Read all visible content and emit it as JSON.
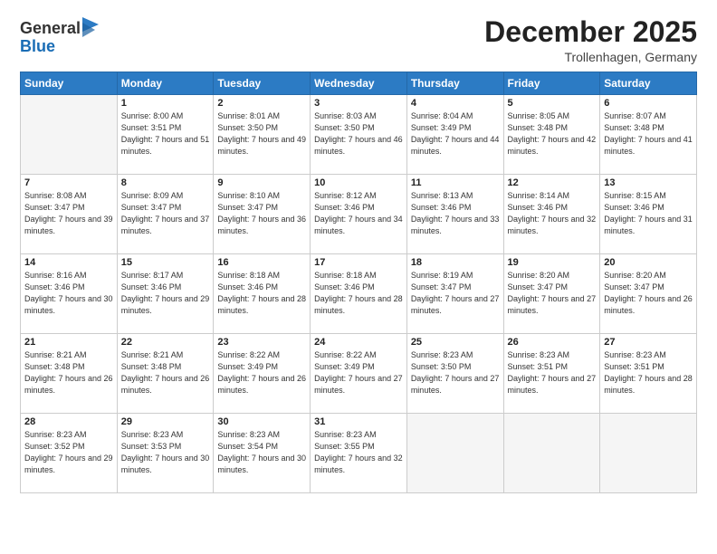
{
  "header": {
    "logo": {
      "line1": "General",
      "line2": "Blue"
    },
    "title": "December 2025",
    "location": "Trollenhagen, Germany"
  },
  "days_of_week": [
    "Sunday",
    "Monday",
    "Tuesday",
    "Wednesday",
    "Thursday",
    "Friday",
    "Saturday"
  ],
  "weeks": [
    [
      {
        "day": "",
        "sunrise": "",
        "sunset": "",
        "daylight": ""
      },
      {
        "day": "1",
        "sunrise": "Sunrise: 8:00 AM",
        "sunset": "Sunset: 3:51 PM",
        "daylight": "Daylight: 7 hours and 51 minutes."
      },
      {
        "day": "2",
        "sunrise": "Sunrise: 8:01 AM",
        "sunset": "Sunset: 3:50 PM",
        "daylight": "Daylight: 7 hours and 49 minutes."
      },
      {
        "day": "3",
        "sunrise": "Sunrise: 8:03 AM",
        "sunset": "Sunset: 3:50 PM",
        "daylight": "Daylight: 7 hours and 46 minutes."
      },
      {
        "day": "4",
        "sunrise": "Sunrise: 8:04 AM",
        "sunset": "Sunset: 3:49 PM",
        "daylight": "Daylight: 7 hours and 44 minutes."
      },
      {
        "day": "5",
        "sunrise": "Sunrise: 8:05 AM",
        "sunset": "Sunset: 3:48 PM",
        "daylight": "Daylight: 7 hours and 42 minutes."
      },
      {
        "day": "6",
        "sunrise": "Sunrise: 8:07 AM",
        "sunset": "Sunset: 3:48 PM",
        "daylight": "Daylight: 7 hours and 41 minutes."
      }
    ],
    [
      {
        "day": "7",
        "sunrise": "Sunrise: 8:08 AM",
        "sunset": "Sunset: 3:47 PM",
        "daylight": "Daylight: 7 hours and 39 minutes."
      },
      {
        "day": "8",
        "sunrise": "Sunrise: 8:09 AM",
        "sunset": "Sunset: 3:47 PM",
        "daylight": "Daylight: 7 hours and 37 minutes."
      },
      {
        "day": "9",
        "sunrise": "Sunrise: 8:10 AM",
        "sunset": "Sunset: 3:47 PM",
        "daylight": "Daylight: 7 hours and 36 minutes."
      },
      {
        "day": "10",
        "sunrise": "Sunrise: 8:12 AM",
        "sunset": "Sunset: 3:46 PM",
        "daylight": "Daylight: 7 hours and 34 minutes."
      },
      {
        "day": "11",
        "sunrise": "Sunrise: 8:13 AM",
        "sunset": "Sunset: 3:46 PM",
        "daylight": "Daylight: 7 hours and 33 minutes."
      },
      {
        "day": "12",
        "sunrise": "Sunrise: 8:14 AM",
        "sunset": "Sunset: 3:46 PM",
        "daylight": "Daylight: 7 hours and 32 minutes."
      },
      {
        "day": "13",
        "sunrise": "Sunrise: 8:15 AM",
        "sunset": "Sunset: 3:46 PM",
        "daylight": "Daylight: 7 hours and 31 minutes."
      }
    ],
    [
      {
        "day": "14",
        "sunrise": "Sunrise: 8:16 AM",
        "sunset": "Sunset: 3:46 PM",
        "daylight": "Daylight: 7 hours and 30 minutes."
      },
      {
        "day": "15",
        "sunrise": "Sunrise: 8:17 AM",
        "sunset": "Sunset: 3:46 PM",
        "daylight": "Daylight: 7 hours and 29 minutes."
      },
      {
        "day": "16",
        "sunrise": "Sunrise: 8:18 AM",
        "sunset": "Sunset: 3:46 PM",
        "daylight": "Daylight: 7 hours and 28 minutes."
      },
      {
        "day": "17",
        "sunrise": "Sunrise: 8:18 AM",
        "sunset": "Sunset: 3:46 PM",
        "daylight": "Daylight: 7 hours and 28 minutes."
      },
      {
        "day": "18",
        "sunrise": "Sunrise: 8:19 AM",
        "sunset": "Sunset: 3:47 PM",
        "daylight": "Daylight: 7 hours and 27 minutes."
      },
      {
        "day": "19",
        "sunrise": "Sunrise: 8:20 AM",
        "sunset": "Sunset: 3:47 PM",
        "daylight": "Daylight: 7 hours and 27 minutes."
      },
      {
        "day": "20",
        "sunrise": "Sunrise: 8:20 AM",
        "sunset": "Sunset: 3:47 PM",
        "daylight": "Daylight: 7 hours and 26 minutes."
      }
    ],
    [
      {
        "day": "21",
        "sunrise": "Sunrise: 8:21 AM",
        "sunset": "Sunset: 3:48 PM",
        "daylight": "Daylight: 7 hours and 26 minutes."
      },
      {
        "day": "22",
        "sunrise": "Sunrise: 8:21 AM",
        "sunset": "Sunset: 3:48 PM",
        "daylight": "Daylight: 7 hours and 26 minutes."
      },
      {
        "day": "23",
        "sunrise": "Sunrise: 8:22 AM",
        "sunset": "Sunset: 3:49 PM",
        "daylight": "Daylight: 7 hours and 26 minutes."
      },
      {
        "day": "24",
        "sunrise": "Sunrise: 8:22 AM",
        "sunset": "Sunset: 3:49 PM",
        "daylight": "Daylight: 7 hours and 27 minutes."
      },
      {
        "day": "25",
        "sunrise": "Sunrise: 8:23 AM",
        "sunset": "Sunset: 3:50 PM",
        "daylight": "Daylight: 7 hours and 27 minutes."
      },
      {
        "day": "26",
        "sunrise": "Sunrise: 8:23 AM",
        "sunset": "Sunset: 3:51 PM",
        "daylight": "Daylight: 7 hours and 27 minutes."
      },
      {
        "day": "27",
        "sunrise": "Sunrise: 8:23 AM",
        "sunset": "Sunset: 3:51 PM",
        "daylight": "Daylight: 7 hours and 28 minutes."
      }
    ],
    [
      {
        "day": "28",
        "sunrise": "Sunrise: 8:23 AM",
        "sunset": "Sunset: 3:52 PM",
        "daylight": "Daylight: 7 hours and 29 minutes."
      },
      {
        "day": "29",
        "sunrise": "Sunrise: 8:23 AM",
        "sunset": "Sunset: 3:53 PM",
        "daylight": "Daylight: 7 hours and 30 minutes."
      },
      {
        "day": "30",
        "sunrise": "Sunrise: 8:23 AM",
        "sunset": "Sunset: 3:54 PM",
        "daylight": "Daylight: 7 hours and 30 minutes."
      },
      {
        "day": "31",
        "sunrise": "Sunrise: 8:23 AM",
        "sunset": "Sunset: 3:55 PM",
        "daylight": "Daylight: 7 hours and 32 minutes."
      },
      {
        "day": "",
        "sunrise": "",
        "sunset": "",
        "daylight": ""
      },
      {
        "day": "",
        "sunrise": "",
        "sunset": "",
        "daylight": ""
      },
      {
        "day": "",
        "sunrise": "",
        "sunset": "",
        "daylight": ""
      }
    ]
  ]
}
